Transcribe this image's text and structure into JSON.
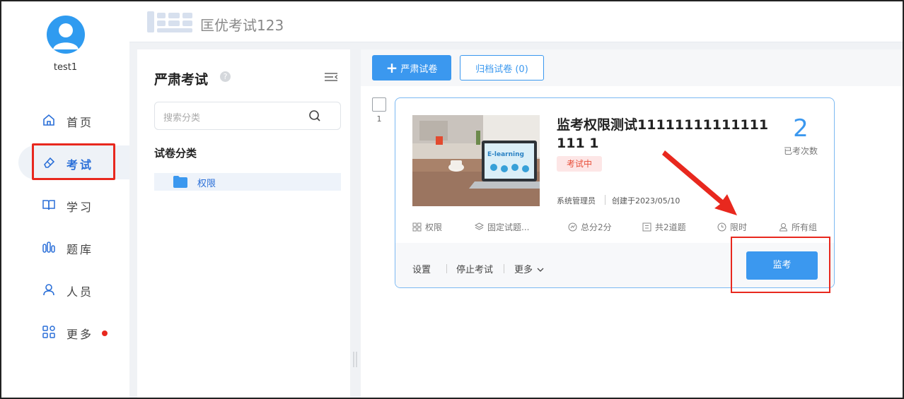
{
  "user": {
    "name": "test1"
  },
  "nav": [
    {
      "label": "首页",
      "icon": "home-icon"
    },
    {
      "label": "考试",
      "icon": "eraser-icon",
      "active": true
    },
    {
      "label": "学习",
      "icon": "book-icon"
    },
    {
      "label": "题库",
      "icon": "bar-chart-icon"
    },
    {
      "label": "人员",
      "icon": "person-icon"
    },
    {
      "label": "更多",
      "icon": "apps-icon",
      "badge": true
    }
  ],
  "header": {
    "title": "匡优考试123"
  },
  "category_panel": {
    "title": "严肃考试",
    "search_placeholder": "搜索分类",
    "section_title": "试卷分类",
    "items": [
      {
        "label": "权限"
      }
    ]
  },
  "toolbar": {
    "create_label": "严肃试卷",
    "archive_label": "归档试卷 (0)"
  },
  "exam": {
    "row_number": "1",
    "title": "监考权限测试11111111111111111 1",
    "status": "考试中",
    "attempts": "2",
    "attempts_label": "已考次数",
    "author": "系统管理员",
    "created": "创建于2023/05/10",
    "meta": {
      "permission": "权限",
      "fixed": "固定试题...",
      "score": "总分2分",
      "questions": "共2道题",
      "timed": "限时",
      "groups": "所有组"
    },
    "footer": {
      "settings": "设置",
      "stop": "停止考试",
      "more": "更多",
      "monitor": "监考"
    }
  },
  "colors": {
    "accent": "#3b98ef",
    "active_nav": "#2a6fd8",
    "annotation_red": "#e8281e",
    "status_bg": "#fde6e6",
    "status_text": "#e8503a"
  }
}
